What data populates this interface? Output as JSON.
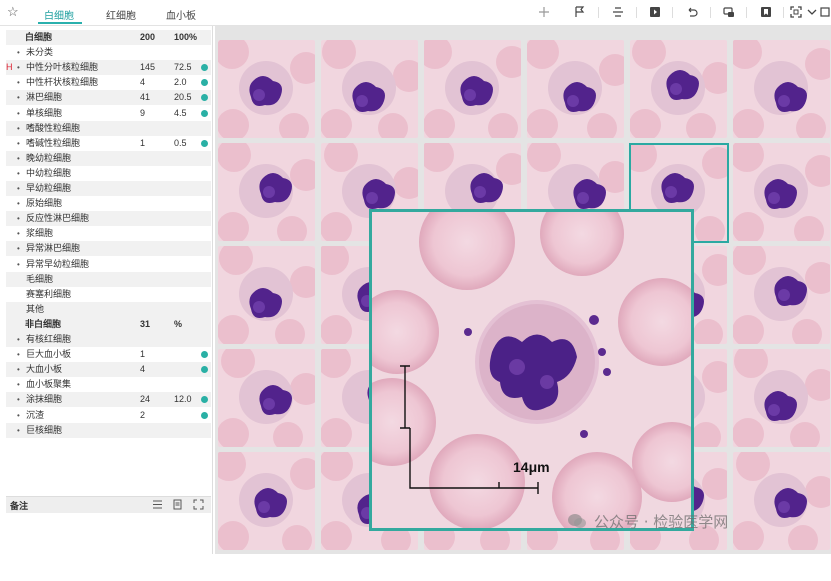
{
  "tabs": [
    {
      "label": "白细胞",
      "active": true
    },
    {
      "label": "红细胞",
      "active": false
    },
    {
      "label": "血小板",
      "active": false
    }
  ],
  "toolbar_icons": [
    "plus-target-icon",
    "flag-icon",
    "split-icon",
    "play-icon",
    "undo-icon",
    "link-icon",
    "bookmark-icon",
    "fullscreen-icon",
    "chevron-down-icon"
  ],
  "wbc_section": {
    "name": "白细胞",
    "count": "200",
    "percent": "100%"
  },
  "wbc_rows": [
    {
      "name": "未分类",
      "count": "",
      "pct": "",
      "dot": false,
      "flag": ""
    },
    {
      "name": "中性分叶核粒细胞",
      "count": "145",
      "pct": "72.5",
      "dot": true,
      "flag": "H"
    },
    {
      "name": "中性杆状核粒细胞",
      "count": "4",
      "pct": "2.0",
      "dot": true,
      "flag": ""
    },
    {
      "name": "淋巴细胞",
      "count": "41",
      "pct": "20.5",
      "dot": true,
      "flag": ""
    },
    {
      "name": "单核细胞",
      "count": "9",
      "pct": "4.5",
      "dot": true,
      "flag": ""
    },
    {
      "name": "嗜酸性粒细胞",
      "count": "",
      "pct": "",
      "dot": false,
      "flag": ""
    },
    {
      "name": "嗜碱性粒细胞",
      "count": "1",
      "pct": "0.5",
      "dot": true,
      "flag": ""
    },
    {
      "name": "晚幼粒细胞",
      "count": "",
      "pct": "",
      "dot": false,
      "flag": ""
    },
    {
      "name": "中幼粒细胞",
      "count": "",
      "pct": "",
      "dot": false,
      "flag": ""
    },
    {
      "name": "早幼粒细胞",
      "count": "",
      "pct": "",
      "dot": false,
      "flag": ""
    },
    {
      "name": "原始细胞",
      "count": "",
      "pct": "",
      "dot": false,
      "flag": ""
    },
    {
      "name": "反应性淋巴细胞",
      "count": "",
      "pct": "",
      "dot": false,
      "flag": ""
    },
    {
      "name": "浆细胞",
      "count": "",
      "pct": "",
      "dot": false,
      "flag": ""
    },
    {
      "name": "异常淋巴细胞",
      "count": "",
      "pct": "",
      "dot": false,
      "flag": ""
    },
    {
      "name": "异常早幼粒细胞",
      "count": "",
      "pct": "",
      "dot": false,
      "flag": ""
    },
    {
      "name": "毛细胞",
      "count": "",
      "pct": "",
      "dot": false,
      "flag": "",
      "nobullet": true
    },
    {
      "name": "赛塞利细胞",
      "count": "",
      "pct": "",
      "dot": false,
      "flag": "",
      "nobullet": true
    },
    {
      "name": "其他",
      "count": "",
      "pct": "",
      "dot": false,
      "flag": "",
      "nobullet": true
    }
  ],
  "nonwbc_section": {
    "name": "非白细胞",
    "count": "31",
    "percent": "%"
  },
  "nonwbc_rows": [
    {
      "name": "有核红细胞",
      "count": "",
      "pct": "",
      "dot": false
    },
    {
      "name": "巨大血小板",
      "count": "1",
      "pct": "",
      "dot": true
    },
    {
      "name": "大血小板",
      "count": "4",
      "pct": "",
      "dot": true
    },
    {
      "name": "血小板聚集",
      "count": "",
      "pct": "",
      "dot": false
    },
    {
      "name": "涂抹细胞",
      "count": "24",
      "pct": "12.0",
      "dot": true
    },
    {
      "name": "沉渣",
      "count": "2",
      "pct": "",
      "dot": true
    },
    {
      "name": "巨核细胞",
      "count": "",
      "pct": "",
      "dot": false
    }
  ],
  "notes": {
    "label": "备注"
  },
  "zoom": {
    "scale_label": "14μm"
  },
  "watermark": "公众号 · 检验医学网",
  "colors": {
    "accent": "#2ab0a5",
    "selection_border": "#2aa9a2",
    "nucleus": "#5b2a8f",
    "rbc": "#e7b8c8",
    "flag_high": "#d22233"
  }
}
